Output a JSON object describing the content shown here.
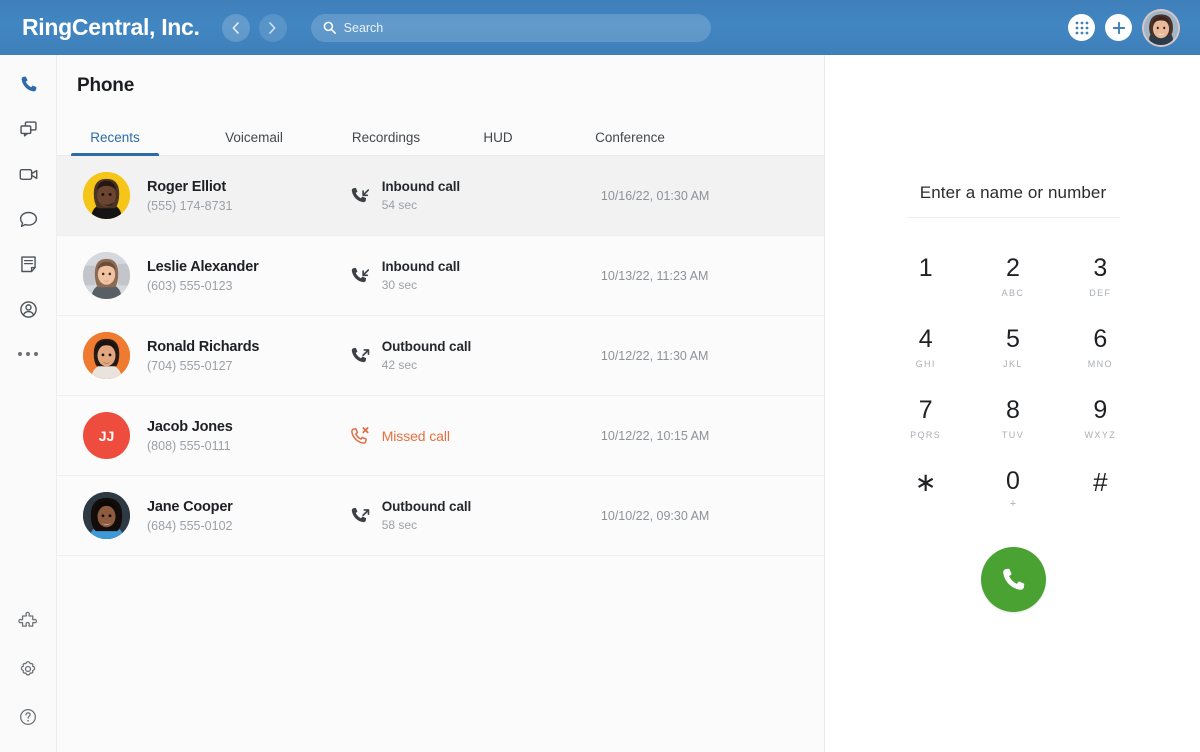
{
  "header": {
    "brand": "RingCentral, Inc.",
    "back_label": "‹",
    "forward_label": "›",
    "search_placeholder": "Search",
    "search_value": "",
    "search_icon": "search-icon",
    "dialpad_icon": "dialpad-icon",
    "add_icon": "plus-icon",
    "avatar": "user-avatar",
    "bg_color": "#4186c2"
  },
  "sidebar": {
    "top_items": [
      {
        "name": "phone",
        "icon": "phone-icon",
        "active": true
      },
      {
        "name": "messages",
        "icon": "message-windows-icon",
        "active": false
      },
      {
        "name": "video",
        "icon": "video-camera-icon",
        "active": false
      },
      {
        "name": "chat",
        "icon": "chat-bubble-icon",
        "active": false
      },
      {
        "name": "tasks",
        "icon": "note-document-icon",
        "active": false
      },
      {
        "name": "contacts",
        "icon": "contact-person-icon",
        "active": false
      },
      {
        "name": "more",
        "icon": "more-dots-icon",
        "active": false
      }
    ],
    "bottom_items": [
      {
        "name": "apps",
        "icon": "puzzle-piece-icon"
      },
      {
        "name": "settings",
        "icon": "gear-icon"
      },
      {
        "name": "help",
        "icon": "question-circle-icon"
      }
    ],
    "active_color": "#2b6ca9"
  },
  "main": {
    "title": "Phone",
    "tabs": [
      {
        "label": "Recents",
        "active": true
      },
      {
        "label": "Voicemail",
        "active": false
      },
      {
        "label": "Recordings",
        "active": false
      },
      {
        "label": "HUD",
        "active": false
      },
      {
        "label": "Conference",
        "active": false
      }
    ],
    "calls": [
      {
        "name": "Roger Elliot",
        "phone": "(555) 174-8731",
        "call_type": "Inbound call",
        "direction": "inbound",
        "duration": "54 sec",
        "timestamp": "10/16/22, 01:30 AM",
        "selected": true,
        "avatar_bg": "#f5c518",
        "initials": ""
      },
      {
        "name": "Leslie Alexander",
        "phone": "(603) 555-0123",
        "call_type": "Inbound call",
        "direction": "inbound",
        "duration": "30 sec",
        "timestamp": "10/13/22, 11:23 AM",
        "selected": false,
        "avatar_bg": "#c9ccd0",
        "initials": ""
      },
      {
        "name": "Ronald Richards",
        "phone": "(704) 555-0127",
        "call_type": "Outbound call",
        "direction": "outbound",
        "duration": "42 sec",
        "timestamp": "10/12/22, 11:30 AM",
        "selected": false,
        "avatar_bg": "#ef7b31",
        "initials": ""
      },
      {
        "name": "Jacob Jones",
        "phone": "(808) 555-0111",
        "call_type": "Missed call",
        "direction": "missed",
        "duration": "",
        "timestamp": "10/12/22, 10:15 AM",
        "selected": false,
        "avatar_bg": "#ee4d3d",
        "initials": "JJ"
      },
      {
        "name": "Jane Cooper",
        "phone": "(684) 555-0102",
        "call_type": "Outbound call",
        "direction": "outbound",
        "duration": "58 sec",
        "timestamp": "10/10/22, 09:30 AM",
        "selected": false,
        "avatar_bg": "#2f3b44",
        "initials": ""
      }
    ],
    "missed_color": "#e5703f"
  },
  "dialpad": {
    "entry_placeholder": "Enter a name or number",
    "entry_value": "",
    "keys": [
      {
        "digit": "1",
        "letters": ""
      },
      {
        "digit": "2",
        "letters": "ABC"
      },
      {
        "digit": "3",
        "letters": "DEF"
      },
      {
        "digit": "4",
        "letters": "GHI"
      },
      {
        "digit": "5",
        "letters": "JKL"
      },
      {
        "digit": "6",
        "letters": "MNO"
      },
      {
        "digit": "7",
        "letters": "PQRS"
      },
      {
        "digit": "8",
        "letters": "TUV"
      },
      {
        "digit": "9",
        "letters": "WXYZ"
      },
      {
        "digit": "∗",
        "letters": ""
      },
      {
        "digit": "0",
        "letters": "+"
      },
      {
        "digit": "#",
        "letters": ""
      }
    ],
    "call_button_icon": "phone-icon",
    "call_button_color": "#4aa233"
  }
}
